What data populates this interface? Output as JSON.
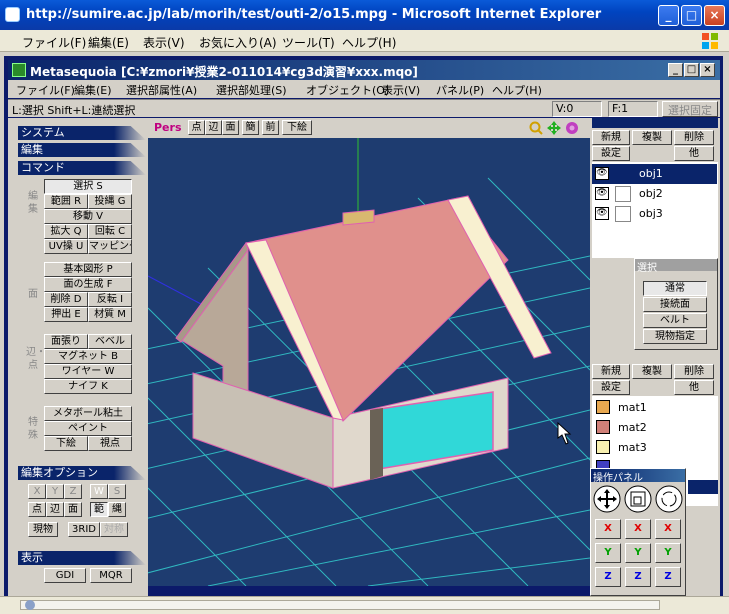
{
  "browser": {
    "title": "http://sumire.ac.jp/lab/morih/test/outi-2/o15.mpg - Microsoft Internet Explorer",
    "menu": [
      "ファイル(F)",
      "編集(E)",
      "表示(V)",
      "お気に入り(A)",
      "ツール(T)",
      "ヘルプ(H)"
    ],
    "buttons": {
      "minimize": "_",
      "maximize": "□",
      "close": "×"
    }
  },
  "app": {
    "title": "Metasequoia [C:¥zmori¥授業2-011014¥cg3d演習¥xxx.mqo]",
    "menu": [
      "ファイル(F)",
      "編集(E)",
      "選択部属性(A)",
      "選択部処理(S)",
      "オブジェクト(O)",
      "表示(V)",
      "パネル(P)",
      "ヘルプ(H)"
    ],
    "status": {
      "hint": "L:選択  Shift+L:連続選択",
      "v": "V:0",
      "f": "F:1",
      "lock": "選択固定"
    }
  },
  "left": {
    "sections": {
      "system": "システム",
      "edit": "編集",
      "command": "コマンド",
      "edit_option": "編集オプション",
      "display": "表示"
    },
    "groups": {
      "edit": "編集",
      "face": "面",
      "edge": "辺・点",
      "special": "特殊"
    },
    "commands": {
      "select": "選択 S",
      "range": "範囲 R",
      "lasso": "投縄 G",
      "move": "移動 V",
      "scale": "拡大 Q",
      "rotate": "回転 C",
      "uv": "UV操 U",
      "mapping": "マッピング",
      "basic": "基本図形 P",
      "face_gen": "面の生成 F",
      "delete": "削除 D",
      "invert": "反転 I",
      "extrude": "押出 E",
      "material": "材質 M",
      "face_stretch": "面張り",
      "bevel": "ベベル",
      "magnet": "マグネット B",
      "wire": "ワイヤー W",
      "knife": "ナイフ K",
      "metaball": "メタボール粘土",
      "paint": "ペイント",
      "underlay": "下絵",
      "viewpoint": "視点"
    },
    "options": {
      "x": "X",
      "y": "Y",
      "z": "Z",
      "w": "W",
      "s": "S",
      "point": "点",
      "edge": "辺",
      "face": "面",
      "range": "範",
      "lasso": "縄",
      "current": "現物",
      "grid": "3RID",
      "sym": "対称"
    },
    "display": {
      "gdi": "GDI",
      "mqr": "MQR"
    }
  },
  "viewport": {
    "toolbar": [
      "Pers",
      "点",
      "辺",
      "面",
      "簡",
      "前",
      "下絵"
    ]
  },
  "objects": {
    "buttons": {
      "new": "新規",
      "copy": "複製",
      "delete": "削除",
      "settings": "設定",
      "other": "他"
    },
    "list": [
      "obj1",
      "obj2",
      "obj3"
    ],
    "selected": "obj1"
  },
  "select_panel": {
    "title": "選択",
    "items": [
      "通常",
      "接続面",
      "ベルト",
      "現物指定"
    ]
  },
  "materials": {
    "buttons": {
      "new": "新規",
      "copy": "複製",
      "delete": "削除",
      "settings": "設定",
      "other": "他"
    },
    "list": [
      {
        "name": "mat1",
        "color": "#e8a850"
      },
      {
        "name": "mat2",
        "color": "#d08078"
      },
      {
        "name": "mat3",
        "color": "#f8f0b0"
      }
    ]
  },
  "ops_panel": {
    "title": "操作パネル",
    "x": "X",
    "y": "Y",
    "z": "Z"
  },
  "colors": {
    "titlebar": "#0a246a",
    "roof": "#e0908c",
    "wall": "#d8ccc0",
    "window": "#30d8d8",
    "door": "#4040b0"
  }
}
